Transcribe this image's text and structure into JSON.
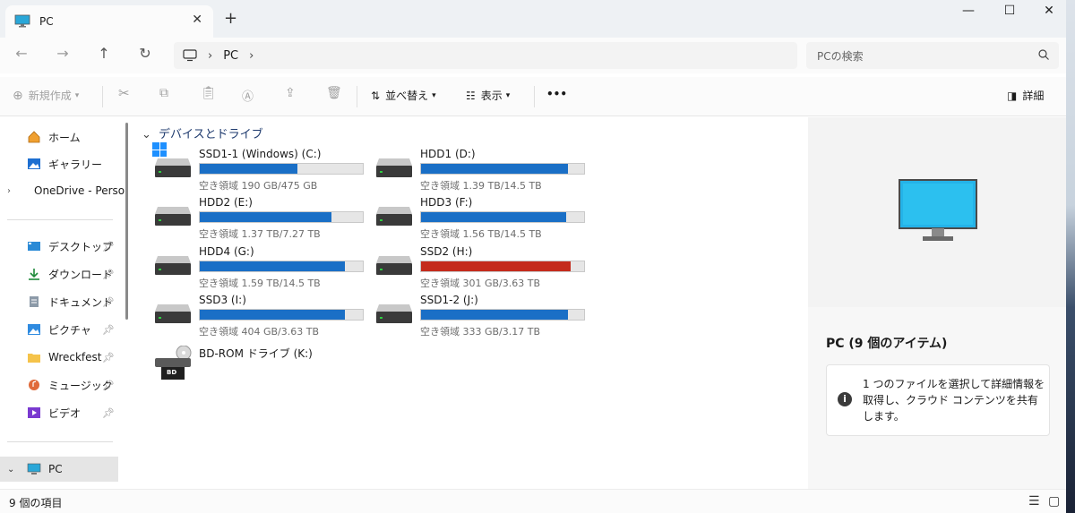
{
  "tab": {
    "title": "PC",
    "close": "✕",
    "new_tab": "+"
  },
  "window_controls": {
    "minimize": "—",
    "maximize": "☐",
    "close": "✕"
  },
  "nav": {
    "back": "←",
    "forward": "→",
    "up": "↑",
    "refresh": "↻"
  },
  "address": {
    "root_sep": "›",
    "location": "PC",
    "trail_sep": "›"
  },
  "search": {
    "placeholder": "PCの検索",
    "icon": "search-icon"
  },
  "command_bar": {
    "new_label": "新規作成",
    "sort_label": "並べ替え",
    "view_label": "表示",
    "more_label": "•••",
    "details_label": "詳細"
  },
  "sidebar": {
    "items": [
      {
        "label": "ホーム",
        "icon": "home-icon"
      },
      {
        "label": "ギャラリー",
        "icon": "gallery-icon"
      },
      {
        "label": "OneDrive - Perso",
        "icon": "cloud-icon"
      },
      {
        "label": "デスクトップ",
        "icon": "desktop-icon",
        "pinned": true
      },
      {
        "label": "ダウンロード",
        "icon": "download-icon",
        "pinned": true
      },
      {
        "label": "ドキュメント",
        "icon": "document-icon",
        "pinned": true
      },
      {
        "label": "ピクチャ",
        "icon": "pictures-icon",
        "pinned": true
      },
      {
        "label": "Wreckfest",
        "icon": "folder-icon",
        "pinned": true
      },
      {
        "label": "ミュージック",
        "icon": "music-icon",
        "pinned": true
      },
      {
        "label": "ビデオ",
        "icon": "video-icon",
        "pinned": true
      },
      {
        "label": "PC",
        "icon": "pc-icon"
      }
    ]
  },
  "content": {
    "group_header": "デバイスとドライブ",
    "drives": [
      {
        "name": "SSD1-1 (Windows) (C:)",
        "free": "空き領域 190 GB/475 GB",
        "used_fraction": 0.6,
        "full": false,
        "windows": true
      },
      {
        "name": "HDD1 (D:)",
        "free": "空き領域 1.39 TB/14.5 TB",
        "used_fraction": 0.9,
        "full": false
      },
      {
        "name": "HDD2 (E:)",
        "free": "空き領域 1.37 TB/7.27 TB",
        "used_fraction": 0.81,
        "full": false
      },
      {
        "name": "HDD3 (F:)",
        "free": "空き領域 1.56 TB/14.5 TB",
        "used_fraction": 0.89,
        "full": false
      },
      {
        "name": "HDD4 (G:)",
        "free": "空き領域 1.59 TB/14.5 TB",
        "used_fraction": 0.89,
        "full": false
      },
      {
        "name": "SSD2 (H:)",
        "free": "空き領域 301 GB/3.63 TB",
        "used_fraction": 0.92,
        "full": true
      },
      {
        "name": "SSD3 (I:)",
        "free": "空き領域 404 GB/3.63 TB",
        "used_fraction": 0.89,
        "full": false
      },
      {
        "name": "SSD1-2 (J:)",
        "free": "空き領域 333 GB/3.17 TB",
        "used_fraction": 0.9,
        "full": false
      },
      {
        "name": "BD-ROM ドライブ (K:)",
        "free": "",
        "optical": true,
        "badge": "BD"
      }
    ]
  },
  "details_pane": {
    "title": "PC (9 個のアイテム)",
    "info_text": "1 つのファイルを選択して詳細情報を取得し、クラウド コンテンツを共有します。"
  },
  "status": {
    "count": "9 個の項目"
  },
  "colors": {
    "accent": "#1a6fc6",
    "full": "#c42b1c",
    "group_header": "#1e3a6e"
  }
}
